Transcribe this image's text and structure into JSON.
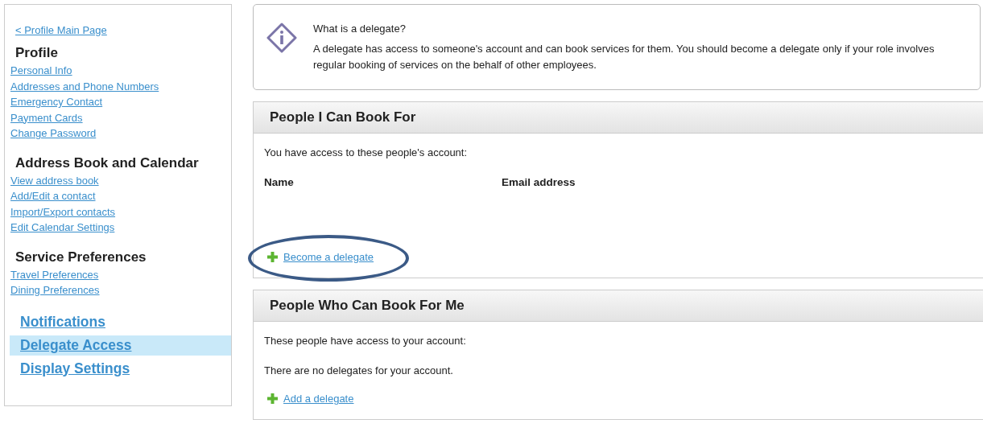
{
  "sidebar": {
    "back_link": "< Profile Main Page",
    "groups": [
      {
        "heading": "Profile",
        "links": [
          "Personal Info",
          "Addresses and Phone Numbers",
          "Emergency Contact",
          "Payment Cards",
          "Change Password"
        ]
      },
      {
        "heading": "Address Book and Calendar",
        "links": [
          "View address book",
          "Add/Edit a contact",
          "Import/Export contacts",
          "Edit Calendar Settings"
        ]
      },
      {
        "heading": "Service Preferences",
        "links": [
          "Travel Preferences",
          "Dining Preferences"
        ]
      }
    ],
    "main_links": [
      {
        "label": "Notifications",
        "selected": false
      },
      {
        "label": "Delegate Access",
        "selected": true
      },
      {
        "label": "Display Settings",
        "selected": false
      }
    ]
  },
  "info": {
    "title": "What is a delegate?",
    "text": "A delegate has access to someone's account and can book services for them. You should become a delegate only if your role involves regular booking of services on the behalf of other employees."
  },
  "sections": [
    {
      "title": "People I Can Book For",
      "intro": "You have access to these people's account:",
      "columns": [
        "Name",
        "Email address"
      ],
      "action": "Become a delegate",
      "circled": true
    },
    {
      "title": "People Who Can Book For Me",
      "intro": "These people have access to your account:",
      "empty_message": "There are no delegates for your account.",
      "action": "Add a delegate",
      "circled": false
    }
  ]
}
